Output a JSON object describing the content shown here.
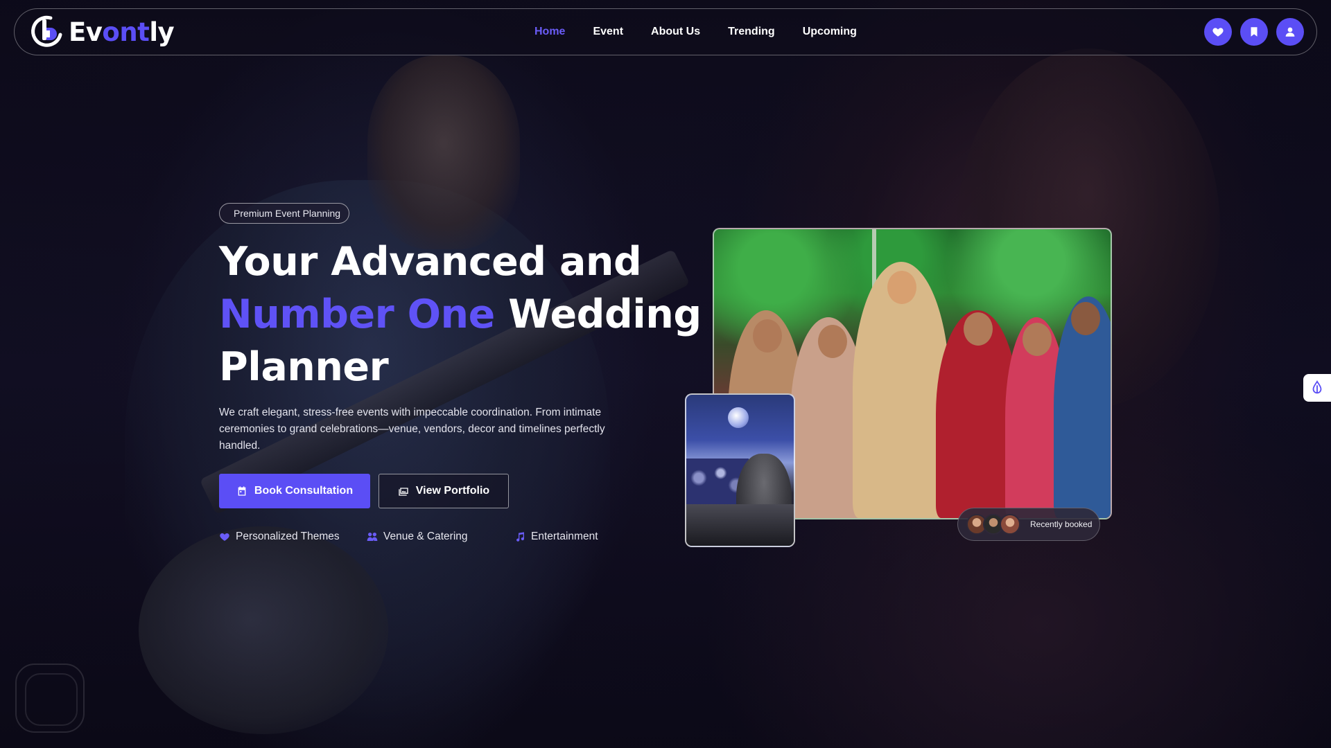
{
  "app": {
    "logo_prefix": "Ev",
    "logo_accent": "ont",
    "logo_suffix": "ly"
  },
  "nav": {
    "items": [
      {
        "label": "Home",
        "active": true
      },
      {
        "label": "Event",
        "active": false
      },
      {
        "label": "About Us",
        "active": false
      },
      {
        "label": "Trending",
        "active": false
      },
      {
        "label": "Upcoming",
        "active": false
      }
    ],
    "action_icons": [
      "heart-icon",
      "bookmark-icon",
      "user-icon"
    ]
  },
  "hero": {
    "badge": "Premium Event Planning",
    "title_line1": "Your Advanced and",
    "title_accent": "Number One",
    "title_after_accent": "Wedding",
    "title_line3": "Planner",
    "description": "We craft elegant, stress-free events with impeccable coordination. From intimate ceremonies to grand celebrations—venue, vendors, decor and timelines perfectly handled.",
    "primary_button": "Book Consultation",
    "secondary_button": "View Portfolio",
    "features": [
      {
        "label": "Personalized Themes",
        "icon": "heart-icon"
      },
      {
        "label": "Venue & Catering",
        "icon": "people-icon"
      },
      {
        "label": "Entertainment",
        "icon": "music-note-icon"
      }
    ]
  },
  "gallery": {
    "recent_label": "Recently booked"
  },
  "colors": {
    "accent": "#5b4ef5",
    "nav_active": "#6a5cf7",
    "background": "#0c0a18"
  }
}
